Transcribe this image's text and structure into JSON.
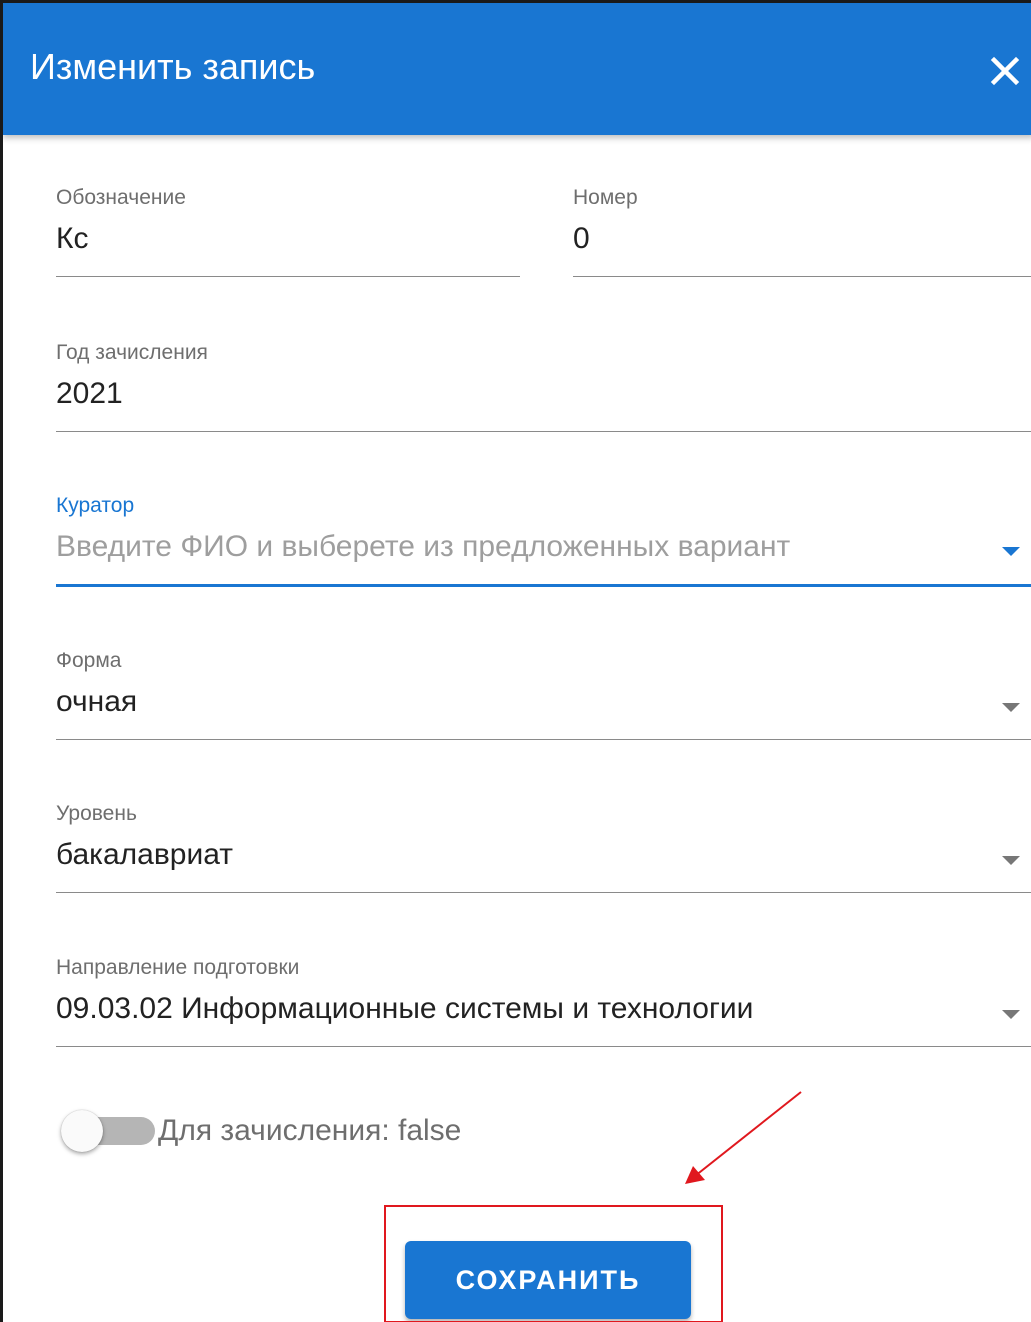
{
  "dialog": {
    "title": "Изменить запись",
    "close_icon": "close-icon"
  },
  "fields": {
    "designation": {
      "label": "Обозначение",
      "value": "Кс"
    },
    "number": {
      "label": "Номер",
      "value": "0"
    },
    "enrollment_year": {
      "label": "Год зачисления",
      "value": "2021"
    },
    "curator": {
      "label": "Куратор",
      "placeholder": "Введите ФИО и выберете из предложенных вариант",
      "focused": true
    },
    "form": {
      "label": "Форма",
      "value": "очная"
    },
    "level": {
      "label": "Уровень",
      "value": "бакалавриат"
    },
    "direction": {
      "label": "Направление подготовки",
      "value": "09.03.02 Информационные системы и технологии"
    }
  },
  "toggle": {
    "label": "Для зачисления: false",
    "checked": false
  },
  "buttons": {
    "save_label": "СОХРАНИТЬ"
  },
  "colors": {
    "primary": "#1976d2",
    "annotation": "#e0181e"
  },
  "annotation": {
    "type": "red arrow and box highlighting save button"
  }
}
